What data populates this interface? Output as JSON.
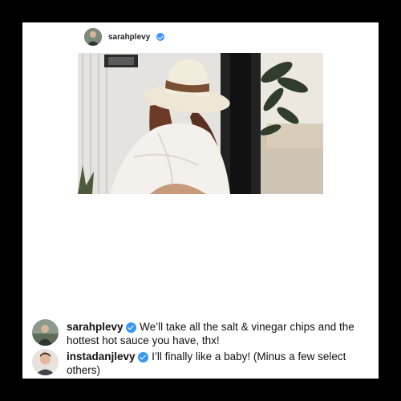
{
  "post": {
    "username": "sarahplevy",
    "verified": true
  },
  "comments": [
    {
      "username": "sarahplevy",
      "verified": true,
      "text": "We’ll take all the salt & vinegar chips and the hottest hot sauce you have, thx!"
    },
    {
      "username": "instadanjlevy",
      "verified": true,
      "text": "I’ll finally like a baby! (Minus a few select others)"
    }
  ],
  "colors": {
    "background": "#000000",
    "card": "#ffffff",
    "verified_badge": "#3897f0"
  },
  "icons": [
    "verified-badge-icon",
    "avatar"
  ]
}
